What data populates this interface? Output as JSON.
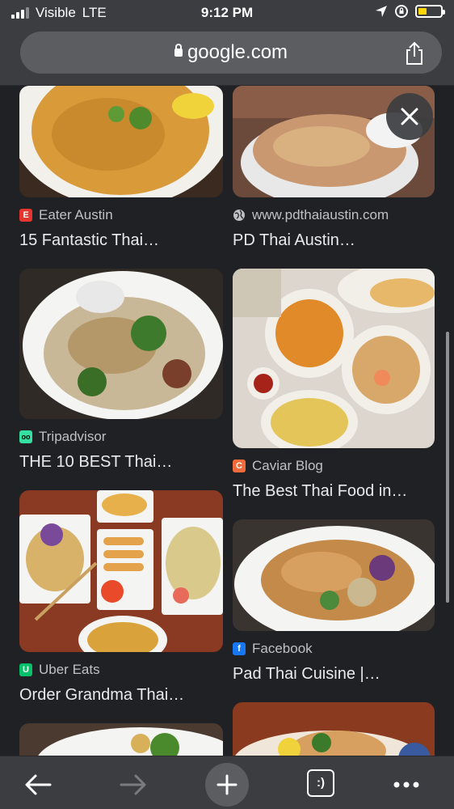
{
  "status_bar": {
    "carrier": "Visible",
    "network": "LTE",
    "time": "9:12 PM",
    "battery_level": 0.4
  },
  "url_bar": {
    "domain": "google.com"
  },
  "results": [
    {
      "source": "Eater Austin",
      "title": "15 Fantastic Thai…",
      "favicon": "eater-icon",
      "favicon_color": "#e4362e",
      "favicon_glyph": "E"
    },
    {
      "source": "www.pdthaiaustin.com",
      "title": "PD Thai Austin…",
      "favicon": "globe-icon"
    },
    {
      "source": "Tripadvisor",
      "title": "THE 10 BEST Thai…",
      "favicon": "tripadvisor-icon",
      "favicon_color": "#34e0a1",
      "favicon_glyph": "oo"
    },
    {
      "source": "Caviar Blog",
      "title": "The Best Thai Food in…",
      "favicon": "caviar-icon",
      "favicon_color": "#f26b3a",
      "favicon_glyph": "C"
    },
    {
      "source": "Uber Eats",
      "title": "Order Grandma Thai…",
      "favicon": "ubereats-icon",
      "favicon_color": "#06c167",
      "favicon_glyph": "U"
    },
    {
      "source": "Facebook",
      "title": "Pad Thai Cuisine |…",
      "favicon": "facebook-icon",
      "favicon_color": "#1877f2",
      "favicon_glyph": "f"
    }
  ],
  "toolbar": {
    "tabs_label": ":)"
  }
}
